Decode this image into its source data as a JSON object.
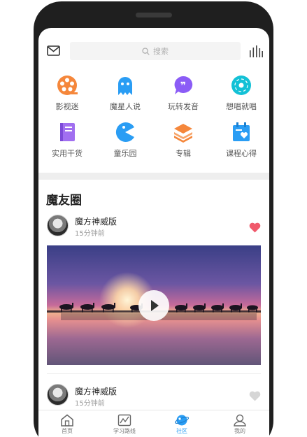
{
  "search": {
    "placeholder": "搜索"
  },
  "categories": [
    {
      "label": "影视迷",
      "icon": "film-reel-icon",
      "color": "#f5873b"
    },
    {
      "label": "魔星人说",
      "icon": "ghost-icon",
      "color": "#2a9df4"
    },
    {
      "label": "玩转发音",
      "icon": "quote-bubble-icon",
      "color": "#8b5cf6"
    },
    {
      "label": "想唱就唱",
      "icon": "music-disc-icon",
      "color": "#13c1d6"
    },
    {
      "label": "实用干货",
      "icon": "book-icon",
      "color": "#a16ff0"
    },
    {
      "label": "童乐园",
      "icon": "pacman-icon",
      "color": "#2a9df4"
    },
    {
      "label": "专辑",
      "icon": "layers-icon",
      "color": "#f5873b"
    },
    {
      "label": "课程心得",
      "icon": "calendar-heart-icon",
      "color": "#2a9df4"
    }
  ],
  "feed": {
    "title": "魔友圈",
    "posts": [
      {
        "author": "魔方神威版",
        "time": "15分钟前",
        "liked": true
      },
      {
        "author": "魔方神威版",
        "time": "15分钟前",
        "liked": false
      }
    ]
  },
  "nav": {
    "items": [
      {
        "label": "首页",
        "icon": "home-icon",
        "active": false
      },
      {
        "label": "学习路线",
        "icon": "route-icon",
        "active": false
      },
      {
        "label": "社区",
        "icon": "planet-icon",
        "active": true
      },
      {
        "label": "我的",
        "icon": "profile-icon",
        "active": false
      }
    ]
  },
  "colors": {
    "accent": "#2a9df4",
    "like": "#f0596b"
  }
}
